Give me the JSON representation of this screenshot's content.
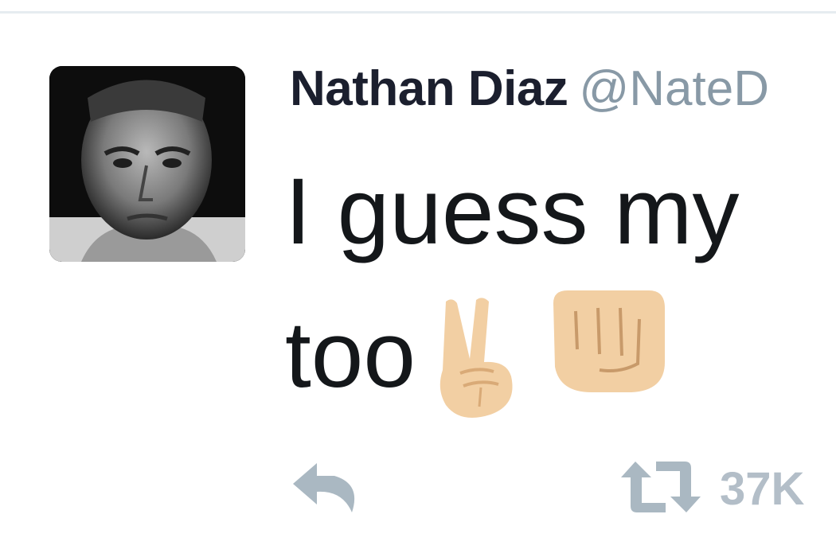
{
  "tweet": {
    "author_name": "Nathan Diaz",
    "author_handle": "@NateD",
    "text_line_1": "I guess my",
    "text_line_2": "too",
    "emojis": [
      "victory-hand",
      "oncoming-fist"
    ]
  },
  "actions": {
    "reply_icon": "reply-icon",
    "retweet_icon": "retweet-icon",
    "retweet_count": "37K"
  },
  "colors": {
    "name": "#1b1f2e",
    "handle": "#8899a6",
    "text": "#14171a",
    "action_icon": "#aab8c2",
    "emoji_skin": "#f2cfa3"
  }
}
